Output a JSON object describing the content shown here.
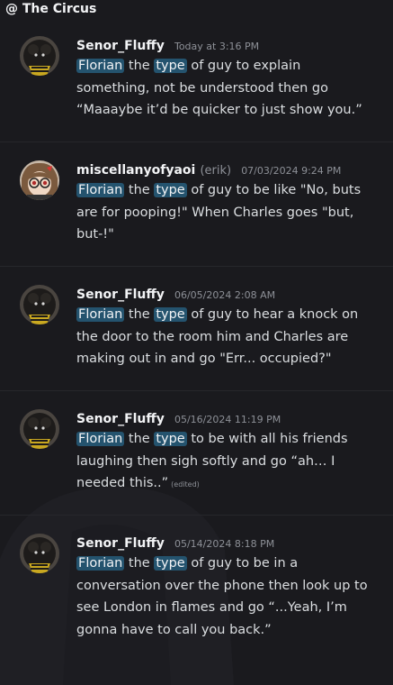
{
  "header": {
    "channel": "@ The Circus"
  },
  "messages": [
    {
      "username": "Senor_Fluffy",
      "pronoun": "",
      "timestamp": "Today at 3:16 PM",
      "word1": "Florian",
      "mid": " the ",
      "word2": "type",
      "text": " of guy to explain something, not be understood then go “Maaaybe it’d be quicker to just show you.”",
      "edited": ""
    },
    {
      "username": "miscellanyofyaoi",
      "pronoun": "(erik)",
      "timestamp": "07/03/2024 9:24 PM",
      "word1": "Florian",
      "mid": " the ",
      "word2": "type",
      "text": " of guy to be like \"No, buts are for pooping!\"  When Charles goes \"but, but-!\"",
      "edited": ""
    },
    {
      "username": "Senor_Fluffy",
      "pronoun": "",
      "timestamp": "06/05/2024 2:08 AM",
      "word1": "Florian",
      "mid": " the ",
      "word2": "type",
      "text": " of guy to hear a knock on the door to the room him and Charles are making out in and go \"Err... occupied?\"",
      "edited": ""
    },
    {
      "username": "Senor_Fluffy",
      "pronoun": "",
      "timestamp": "05/16/2024 11:19 PM",
      "word1": "Florian",
      "mid": " the ",
      "word2": "type",
      "text": " to be with all his friends laughing then sigh softly and go “ah… I needed this..”",
      "edited": "(edited)"
    },
    {
      "username": "Senor_Fluffy",
      "pronoun": "",
      "timestamp": "05/14/2024 8:18 PM",
      "word1": "Florian",
      "mid": " the ",
      "word2": "type",
      "text": " of guy to be in a conversation over the phone then look up to see London in flames and go “...Yeah, I’m gonna have to call you back.”",
      "edited": ""
    }
  ]
}
